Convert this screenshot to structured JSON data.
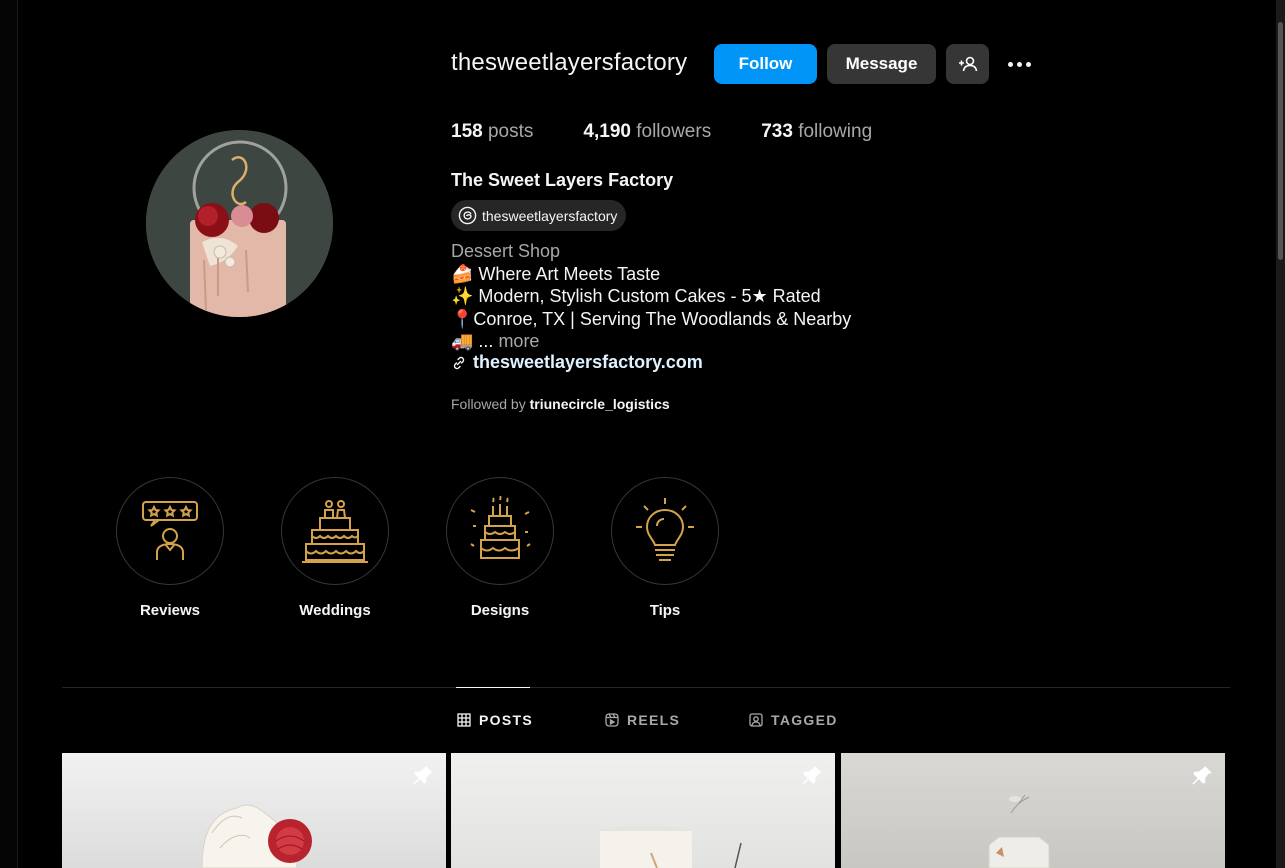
{
  "profile": {
    "username": "thesweetlayersfactory",
    "full_name": "The Sweet Layers Factory",
    "threads_handle": "thesweetlayersfactory"
  },
  "actions": {
    "follow_label": "Follow",
    "message_label": "Message",
    "add_user_icon": "person-add-icon",
    "more_icon": "more-horizontal-icon"
  },
  "stats": {
    "posts_count": "158",
    "posts_label": "posts",
    "followers_count": "4,190",
    "followers_label": "followers",
    "following_count": "733",
    "following_label": "following"
  },
  "bio": {
    "category": "Dessert Shop",
    "lines": [
      {
        "emoji": "🍰",
        "text": " Where Art Meets Taste"
      },
      {
        "emoji": "✨",
        "text": " Modern, Stylish Custom Cakes - 5★ Rated"
      },
      {
        "emoji": "📍",
        "text": "Conroe, TX | Serving The Woodlands & Nearby"
      },
      {
        "emoji": "🚚",
        "text": " ... "
      }
    ],
    "more_label": "more",
    "website": "thesweetlayersfactory.com"
  },
  "followed_by": {
    "prefix": "Followed by",
    "user": "triunecircle_logistics"
  },
  "highlights": [
    {
      "label": "Reviews",
      "icon": "reviews-icon"
    },
    {
      "label": "Weddings",
      "icon": "wedding-cake-icon"
    },
    {
      "label": "Designs",
      "icon": "birthday-cake-icon"
    },
    {
      "label": "Tips",
      "icon": "lightbulb-icon"
    }
  ],
  "tabs": [
    {
      "label": "POSTS",
      "icon": "grid-icon",
      "active": true
    },
    {
      "label": "REELS",
      "icon": "reels-icon",
      "active": false
    },
    {
      "label": "TAGGED",
      "icon": "tagged-icon",
      "active": false
    }
  ],
  "posts": [
    {
      "pinned": true
    },
    {
      "pinned": true
    },
    {
      "pinned": true
    }
  ],
  "colors": {
    "accent_blue": "#0095f6",
    "highlight_gold": "#d4a24a",
    "secondary_button": "#363636",
    "background": "#000000"
  }
}
